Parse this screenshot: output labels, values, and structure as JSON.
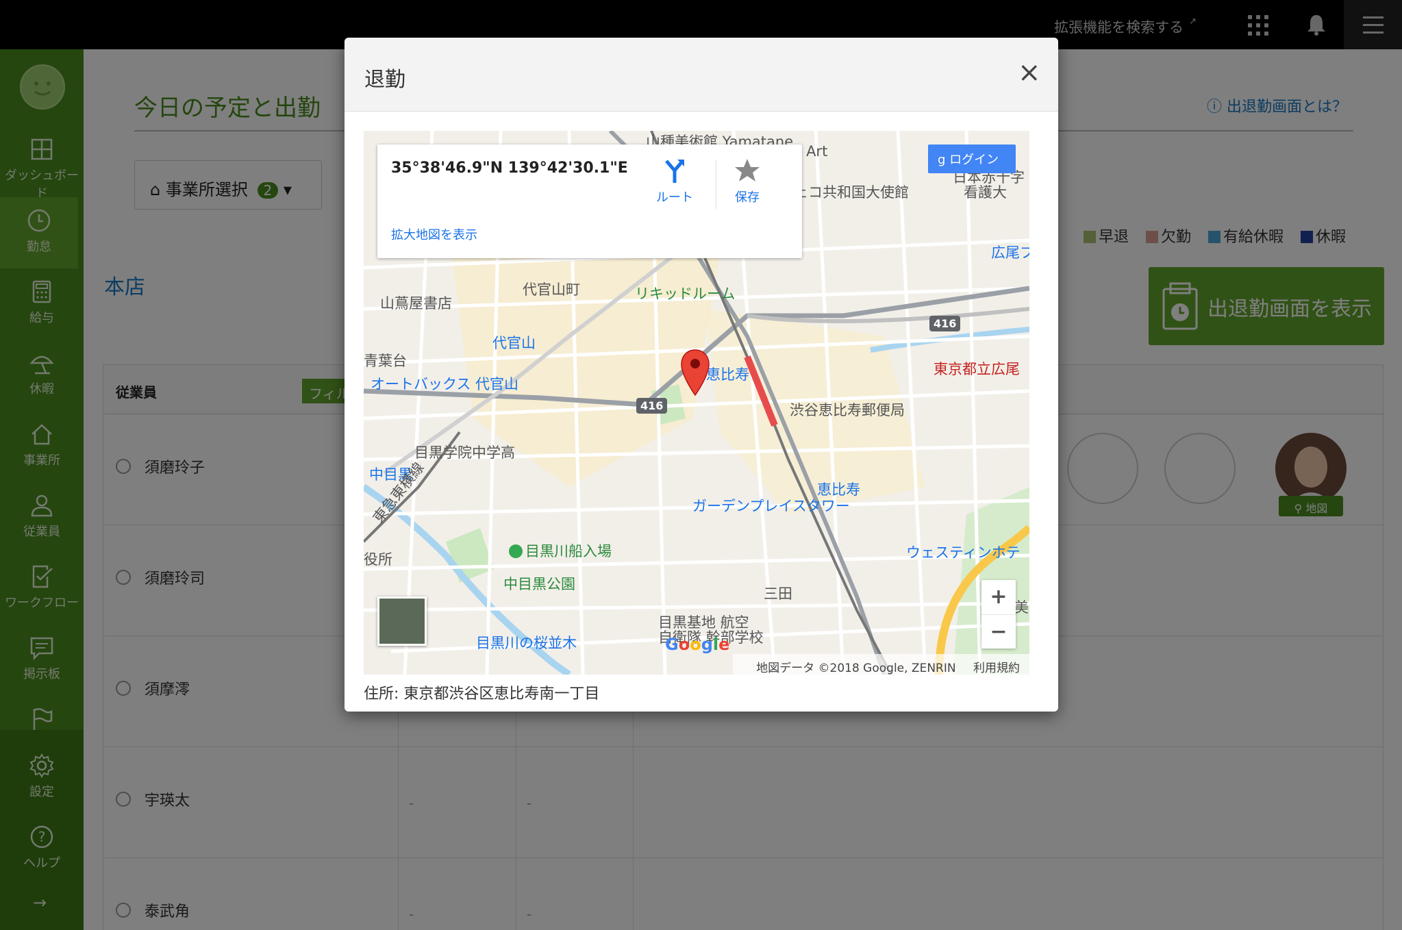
{
  "topbar": {
    "extension_search": "拡張機能を検索する",
    "external_icon": "↗"
  },
  "sidebar": {
    "items": [
      {
        "label": "ダッシュボード",
        "icon": "dashboard-icon"
      },
      {
        "label": "勤怠",
        "icon": "clock-icon"
      },
      {
        "label": "給与",
        "icon": "calculator-icon"
      },
      {
        "label": "休暇",
        "icon": "umbrella-icon"
      },
      {
        "label": "事業所",
        "icon": "home-icon"
      },
      {
        "label": "従業員",
        "icon": "person-icon"
      },
      {
        "label": "ワークフロー",
        "icon": "checklist-icon"
      },
      {
        "label": "掲示板",
        "icon": "message-icon"
      },
      {
        "label": "",
        "icon": "flag-icon"
      },
      {
        "label": "設定",
        "icon": "gear-icon"
      },
      {
        "label": "ヘルプ",
        "icon": "help-icon"
      }
    ],
    "arrow": "→"
  },
  "main": {
    "page_title": "今日の予定と出勤",
    "help_link": "出退勤画面とは？",
    "office_select": {
      "label": "事業所選択",
      "count": "2"
    },
    "legend": [
      "早退",
      "欠勤",
      "有給休暇",
      "休暇"
    ],
    "branch_title": "本店",
    "display_button": "出退勤画面を表示",
    "table": {
      "header": "従業員",
      "filter": "フィル",
      "rows": [
        {
          "name": "須磨玲子"
        },
        {
          "name": "須磨玲司"
        },
        {
          "name": "須摩澪"
        },
        {
          "name": "宇瑛太",
          "dash1": "-",
          "dash2": "-"
        },
        {
          "name": "泰武角",
          "dash1": "-",
          "dash2": "-"
        }
      ]
    },
    "map_badge": "地図"
  },
  "modal": {
    "title": "退勤",
    "close": "×",
    "map": {
      "coords": "35°38'46.9\"N 139°42'30.1\"E",
      "route": "ルート",
      "save": "保存",
      "enlarge": "拡大地図を表示",
      "login": "ログイン",
      "zoom_in": "+",
      "zoom_out": "−",
      "logo": "Google",
      "attribution": "地図データ ©2018 Google, ZENRIN",
      "terms": "利用規約",
      "labels": {
        "yamatane": "山種美術館 Yamatane",
        "art": "f Art",
        "embassy": "ェコ共和国大使館",
        "nurse": "日本赤十字",
        "nurse2": "看護大",
        "hiroo": "広尾ブ",
        "daikanyama_cho": "代官山町",
        "tsutaya": "山蔦屋書店",
        "liquid": "リキッドルーム",
        "daikanyama": "代官山",
        "aobadai": "青葉台",
        "autobacs": "オートバックス 代官山",
        "ebisu": "恵比寿",
        "hospital": "東京都立広尾",
        "post": "渋谷恵比寿郵便局",
        "gakuin": "目黒学院中学高",
        "nakameguro": "中目黒",
        "toyoko": "東急東横線",
        "garden": "恵比寿",
        "garden2": "ガーデンプレイスタワー",
        "westin": "ウェスティンホテ",
        "funairiba": "目黒川船入場",
        "yakusho": "役所",
        "park": "中目黒公園",
        "mita": "三田",
        "base": "目黒基地 航空",
        "base2": "自衛隊 幹部学校",
        "sakura": "目黒川の桜並木",
        "bi": "美",
        "route416a": "416",
        "route416b": "416"
      }
    },
    "address": "住所: 東京都渋谷区恵比寿南一丁目"
  },
  "colors": {
    "sidebar": "#4b8d1e",
    "accent": "#63a42c",
    "link": "#1a78c2",
    "legend_early": "#a8c070",
    "legend_absent": "#d9a090",
    "legend_paid": "#4da6d6",
    "legend_leave": "#2440a0"
  }
}
